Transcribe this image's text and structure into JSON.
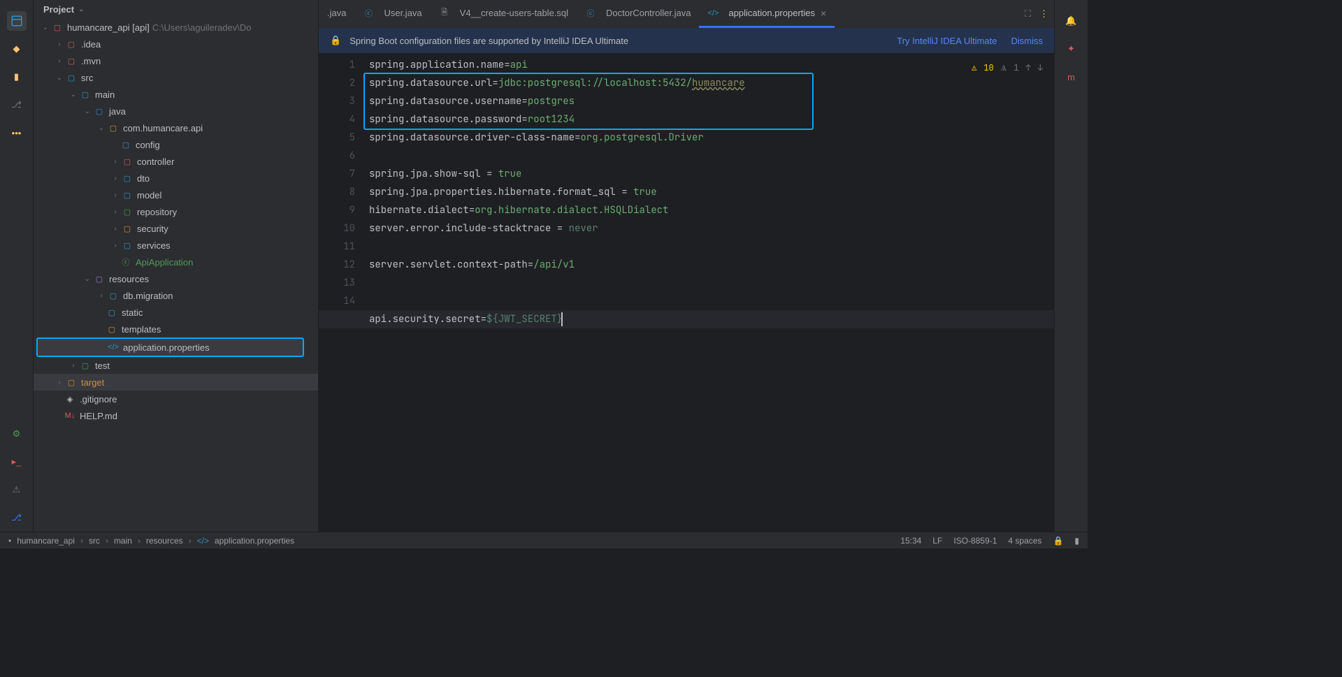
{
  "project_header": "Project",
  "tree": {
    "root_label": "humancare_api",
    "root_suffix_bracket": "[api]",
    "root_path": "C:\\Users\\aguileradev\\Do",
    "idea": ".idea",
    "mvn": ".mvn",
    "src": "src",
    "main": "main",
    "java": "java",
    "pkg": "com.humancare.api",
    "config": "config",
    "controller": "controller",
    "dto": "dto",
    "model": "model",
    "repository": "repository",
    "security": "security",
    "services": "services",
    "apiapp": "ApiApplication",
    "resources": "resources",
    "dbmigration": "db.migration",
    "static": "static",
    "templates": "templates",
    "appprops": "application.properties",
    "test": "test",
    "target": "target",
    "gitignore": ".gitignore",
    "help": "HELP.md"
  },
  "tabs": {
    "t1": ".java",
    "t2": "User.java",
    "t3": "V4__create-users-table.sql",
    "t4": "DoctorController.java",
    "t5": "application.properties"
  },
  "banner": {
    "text": "Spring Boot configuration files are supported by IntelliJ IDEA Ultimate",
    "try": "Try IntelliJ IDEA Ultimate",
    "dismiss": "Dismiss"
  },
  "indicators": {
    "warn": "10",
    "typo": "1"
  },
  "code": {
    "l1_k": "spring.application.name",
    "l1_v": "api",
    "l2_k": "spring.datasource.url",
    "l2_v": "jdbc:postgresql://localhost:5432/",
    "l2_v2": "humancare",
    "l3_k": "spring.datasource.username",
    "l3_v": "postgres",
    "l4_k": "spring.datasource.password",
    "l4_v": "root1234",
    "l5_k": "spring.datasource.driver-class-name",
    "l5_v": "org.postgresql.Driver",
    "l7_k": "spring.jpa.show-sql",
    "l7_v": "true",
    "l8_k": "spring.jpa.properties.hibernate.format_sql",
    "l8_v": "true",
    "l9_k": "hibernate.dialect",
    "l9_v": "org.hibernate.dialect.HSQLDialect",
    "l10_k": "server.error.include-stacktrace",
    "l10_v": "never",
    "l12_k": "server.servlet.context-path",
    "l12_v": "/api/v1",
    "l15_k": "api.security.secret",
    "l15_v": "${JWT_SECRET}"
  },
  "breadcrumb": {
    "s1": "humancare_api",
    "s2": "src",
    "s3": "main",
    "s4": "resources",
    "s5": "application.properties"
  },
  "status": {
    "time": "15:34",
    "le": "LF",
    "enc": "ISO-8859-1",
    "indent": "4 spaces"
  }
}
